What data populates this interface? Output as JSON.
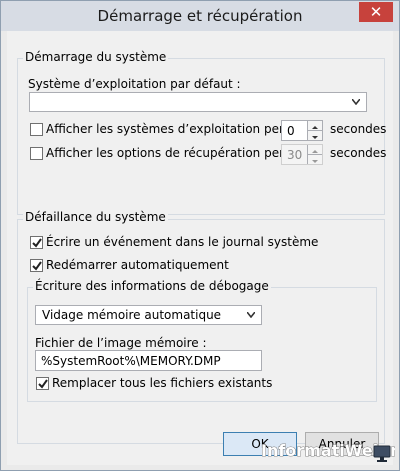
{
  "window": {
    "title": "Démarrage et récupération",
    "close_glyph": "✕"
  },
  "startup": {
    "group_label": "Démarrage du système",
    "default_os_label": "Système d’exploitation par défaut :",
    "default_os_value": "",
    "show_os_list": {
      "label": "Afficher les systèmes d’exploitation pendant :",
      "checked": false,
      "value": "0",
      "unit": "secondes"
    },
    "show_recovery": {
      "label": "Afficher les options de récupération pendant :",
      "checked": false,
      "value": "30",
      "unit": "secondes",
      "disabled": true
    }
  },
  "failure": {
    "group_label": "Défaillance du système",
    "write_event": {
      "label": "Écrire un événement dans le journal système",
      "checked": true
    },
    "auto_restart": {
      "label": "Redémarrer automatiquement",
      "checked": true
    },
    "debug_info": {
      "group_label": "Écriture des informations de débogage",
      "dump_type": "Vidage mémoire automatique",
      "dump_file_label": "Fichier de l’image mémoire :",
      "dump_file_value": "%SystemRoot%\\MEMORY.DMP",
      "overwrite": {
        "label": "Remplacer tous les fichiers existants",
        "checked": true
      }
    }
  },
  "buttons": {
    "ok": "OK",
    "cancel": "Annuler"
  },
  "watermark": {
    "text": "InformatiWeb.net",
    "icon": "monitor-icon"
  },
  "icons": {
    "close": "close-icon",
    "dropdown": "chevron-down-icon",
    "check": "check-icon",
    "spin_up": "arrow-up-icon",
    "spin_down": "arrow-down-icon"
  }
}
